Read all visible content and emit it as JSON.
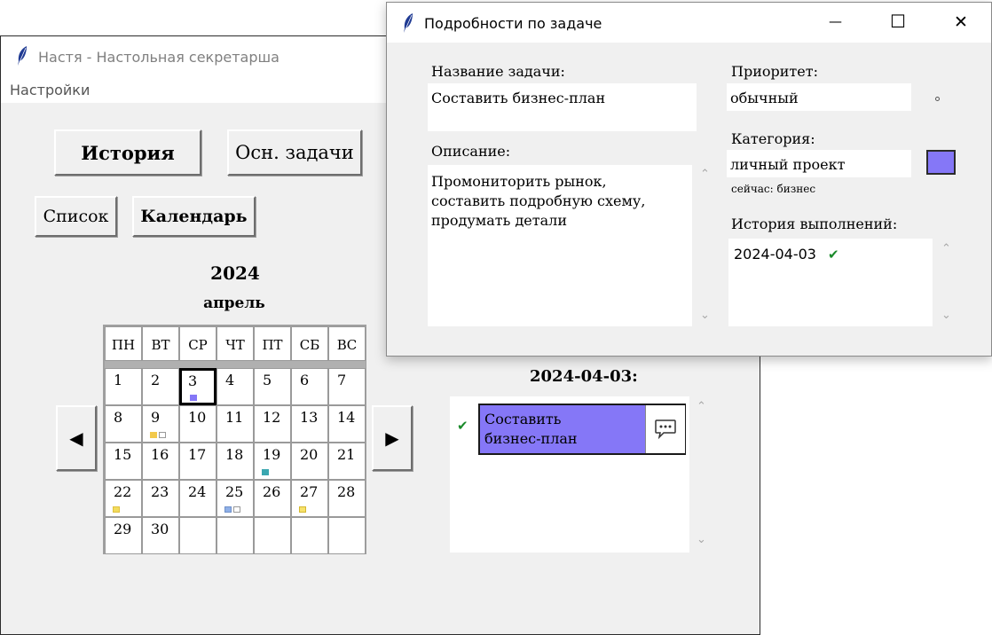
{
  "main_window": {
    "title": "Настя - Настольная секретарша",
    "menu": [
      "Настройки"
    ],
    "buttons": {
      "history": "История",
      "main_tasks": "Осн. задачи",
      "list": "Список",
      "calendar": "Календарь"
    },
    "calendar": {
      "year": "2024",
      "month": "апрель",
      "weekdays": [
        "ПН",
        "ВТ",
        "СР",
        "ЧТ",
        "ПТ",
        "СБ",
        "ВС"
      ],
      "days": [
        "1",
        "2",
        "3",
        "4",
        "5",
        "6",
        "7",
        "8",
        "9",
        "10",
        "11",
        "12",
        "13",
        "14",
        "15",
        "16",
        "17",
        "18",
        "19",
        "20",
        "21",
        "22",
        "23",
        "24",
        "25",
        "26",
        "27",
        "28",
        "29",
        "30"
      ],
      "selected_day": "3",
      "prev_arrow": "◀",
      "next_arrow": "▶"
    },
    "day_panel": {
      "date_label": "2024-04-03:",
      "tasks": [
        {
          "check": "✔",
          "title": "Составить бизнес-план",
          "color": "#8577f7"
        }
      ]
    }
  },
  "dialog": {
    "title": "Подробности по задаче",
    "controls": {
      "minimize": "—",
      "maximize": "☐",
      "close": "✕"
    },
    "name_label": "Название задачи:",
    "name_value": "Составить бизнес-план",
    "description_label": "Описание:",
    "description_value": "Промониторить рынок,\nсоставить подробную схему,\nпродумать детали",
    "priority_label": "Приоритет:",
    "priority_value": "обычный",
    "category_label": "Категория:",
    "category_value": "личный проект",
    "category_current": "сейчас: бизнес",
    "category_color": "#8577f7",
    "history_label": "История выполнений:",
    "history": [
      {
        "date": "2024-04-03",
        "check": "✔"
      }
    ]
  },
  "colors": {
    "accent_purple": "#8577f7",
    "check_green": "#1a8a2a",
    "window_bg": "#f0f0f0"
  }
}
